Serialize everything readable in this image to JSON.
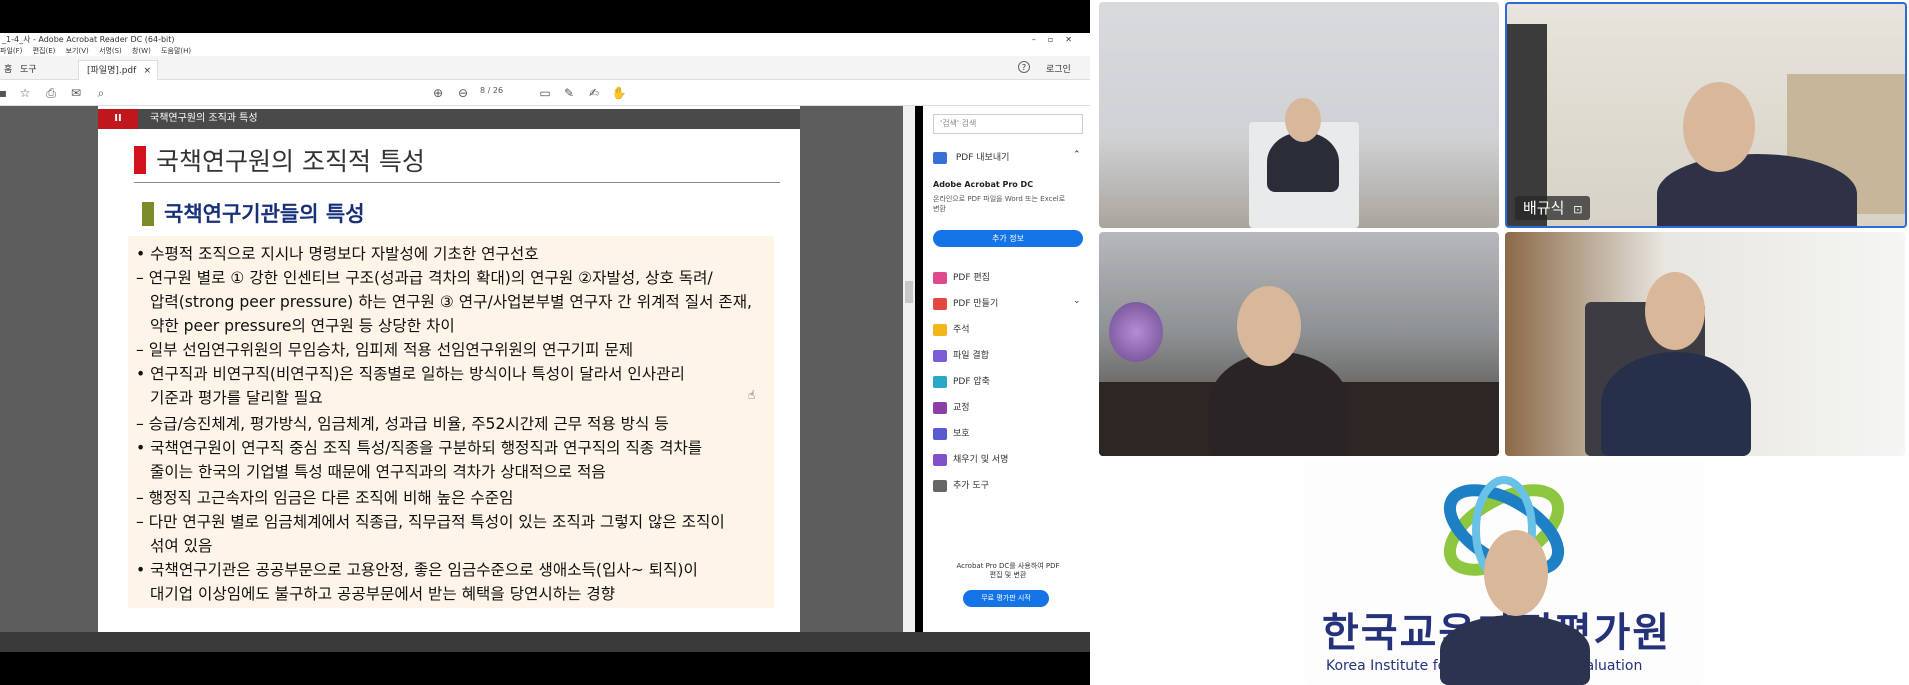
{
  "acrobat": {
    "window_title": "_1-4_사 - Adobe Acrobat Reader DC (64-bit)",
    "menu": [
      "파일(F)",
      "편집(E)",
      "보기(V)",
      "서명(S)",
      "창(W)",
      "도움말(H)"
    ],
    "tabs": {
      "home": "홈",
      "tools": "도구",
      "document": "[파일명].pdf"
    },
    "help": "?",
    "login": "로그인",
    "page_current": "8",
    "page_total": "/ 26"
  },
  "slide": {
    "section_number": "II",
    "section_header": "국책연구원의 조직과 특성",
    "title": "국책연구원의 조직적 특성",
    "subtitle": "국책연구기관들의 특성",
    "lines": [
      "• 수평적 조직으로 지시나 명령보다 자발성에 기초한 연구선호",
      "– 연구원 별로 ① 강한 인센티브 구조(성과급 격차의 확대)의 연구원 ②자발성, 상호 독려/",
      "압력(strong peer pressure) 하는 연구원 ③ 연구/사업본부별 연구자 간 위계적 질서 존재,",
      "약한 peer pressure의 연구원 등 상당한 차이",
      "– 일부 선임연구위원의 무임승차, 임피제 적용 선임연구위원의 연구기피 문제",
      "• 연구직과 비연구직(비연구직)은 직종별로 일하는 방식이나 특성이 달라서 인사관리",
      "기준과 평가를 달리할 필요",
      "– 승급/승진체계, 평가방식, 임금체계, 성과급 비율, 주52시간제 근무 적용 방식 등",
      "• 국책연구원이 연구직 중심 조직 특성/직종을 구분하되 행정직과 연구직의 직종 격차를",
      "줄이는 한국의 기업별 특성 때문에 연구직과의 격차가 상대적으로 적음",
      "– 행정직 고근속자의 임금은 다른 조직에 비해 높은 수준임",
      "– 다만 연구원 별로 임금체계에서 직종급, 직무급적 특성이 있는 조직과 그렇지 않은 조직이",
      "섞여 있음",
      "• 국책연구기관은 공공부문으로 고용안정, 좋은 임금수준으로 생애소득(입사~ 퇴직)이",
      "대기업 이상임에도 불구하고 공공부문에서 받는 혜택을 당연시하는 경향"
    ]
  },
  "right_panel": {
    "search_placeholder": "'검색' 검색",
    "export_pdf": "PDF 내보내기",
    "promo_title": "Adobe Acrobat Pro DC",
    "promo_desc": "온라인으로 PDF 파일을 Word 또는 Excel로 변환",
    "promo_button": "추가 정보",
    "tools": [
      "PDF 편집",
      "PDF 만들기",
      "주석",
      "파일 결합",
      "PDF 압축",
      "교정",
      "보호",
      "채우기 및 서명",
      "추가 도구"
    ],
    "tool_colors": [
      "#e04a8a",
      "#e2483d",
      "#f2b51b",
      "#7b5cd6",
      "#2aa7c9",
      "#8b3ea8",
      "#5a5ad1",
      "#7f52c9",
      "#666666"
    ],
    "trial_text": "Acrobat Pro DC를 사용하여 PDF 편집 및 변환",
    "trial_button": "무료 평가판 시작"
  },
  "participants": {
    "speaker_name": "배규식",
    "org_name_kr": "한국교육과정평가원",
    "org_name_en": "Korea Institute for Curriculum and Evaluation"
  }
}
